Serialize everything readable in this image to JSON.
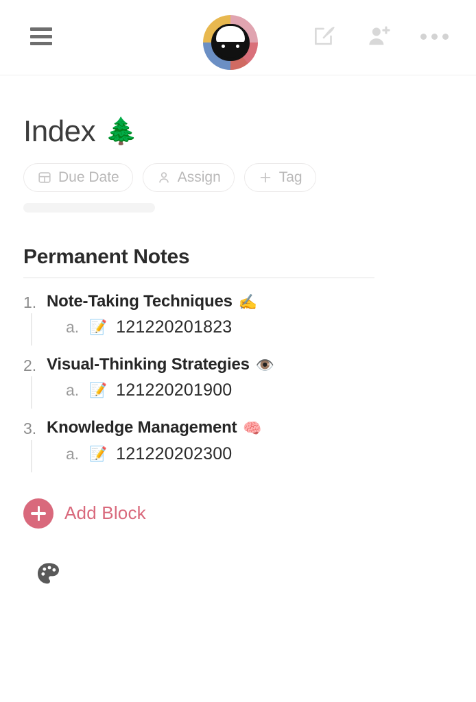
{
  "topbar": {
    "menu_icon": "hamburger-menu-icon",
    "avatar_alt": "sheep-avatar",
    "icons": [
      {
        "name": "compose-icon",
        "label": "Compose"
      },
      {
        "name": "add-person-icon",
        "label": "Add person"
      },
      {
        "name": "more-options-icon",
        "label": "More"
      }
    ]
  },
  "document": {
    "title": "Index",
    "title_emoji": "🌲",
    "pills": [
      {
        "name": "due-date",
        "label": "Due Date",
        "icon": "calendar-icon"
      },
      {
        "name": "assign",
        "label": "Assign",
        "icon": "person-icon"
      },
      {
        "name": "tag",
        "label": "Tag",
        "icon": "plus-icon"
      }
    ],
    "section": {
      "heading": "Permanent Notes",
      "items": [
        {
          "number": "1.",
          "text": "Note-Taking Techniques",
          "emoji": "✍️",
          "sub": {
            "number": "a.",
            "emoji": "📝",
            "text": "121220201823"
          }
        },
        {
          "number": "2.",
          "text": "Visual-Thinking Strategies",
          "emoji": "👁️",
          "sub": {
            "number": "a.",
            "emoji": "📝",
            "text": "121220201900"
          }
        },
        {
          "number": "3.",
          "text": "Knowledge Management",
          "emoji": "🧠",
          "sub": {
            "number": "a.",
            "emoji": "📝",
            "text": "121220202300"
          }
        }
      ]
    },
    "add_block": {
      "label": "Add Block",
      "icon": "plus-icon",
      "color": "#d9697c"
    },
    "palette": {
      "name": "palette-icon"
    }
  }
}
